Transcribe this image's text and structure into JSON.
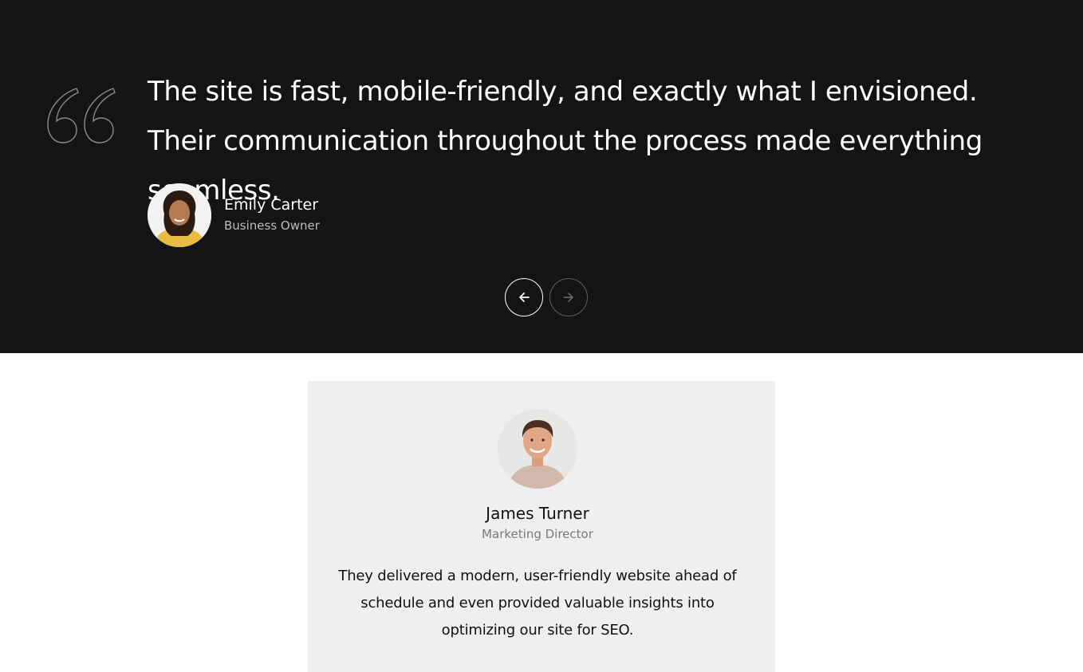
{
  "featured_testimonial": {
    "quote": "The site is fast, mobile-friendly, and exactly what I envisioned. Their communication throughout the process made everything seamless.",
    "author_name": "Emily Carter",
    "author_role": "Business Owner",
    "quote_icon": "quote-icon"
  },
  "carousel_nav": {
    "prev_icon": "arrow-left-icon",
    "next_icon": "arrow-right-icon"
  },
  "testimonial_card": {
    "author_name": "James Turner",
    "author_role": "Marketing Director",
    "quote": "They delivered a modern, user-friendly website ahead of schedule and even provided valuable insights into optimizing our site for SEO."
  },
  "colors": {
    "dark_background": "#141414",
    "card_background": "#efefef",
    "text_light": "#ffffff",
    "text_dark": "#111111"
  }
}
